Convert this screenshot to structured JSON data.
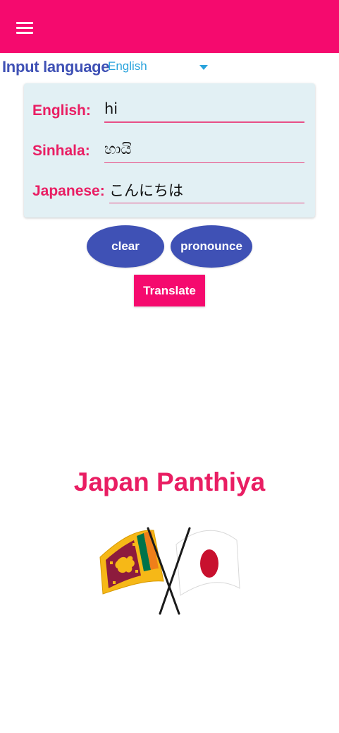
{
  "appbar": {
    "menu_icon": "hamburger-menu-icon",
    "color": "#f50a6e"
  },
  "language": {
    "label": "Input language",
    "selected": "English"
  },
  "fields": {
    "english": {
      "label": "English:",
      "value": "hi"
    },
    "sinhala": {
      "label": "Sinhala:",
      "value": "හායි"
    },
    "japanese": {
      "label": "Japanese:",
      "value": "こんにちは"
    }
  },
  "buttons": {
    "clear": "clear",
    "pronounce": "pronounce",
    "translate": "Translate"
  },
  "app_name": "Japan Panthiya",
  "flags_image": "sri-lanka-japan-crossed-flags",
  "colors": {
    "primary": "#f50a6e",
    "accent": "#3f51b5",
    "link": "#29a3dc",
    "card": "#e2f0f4"
  }
}
